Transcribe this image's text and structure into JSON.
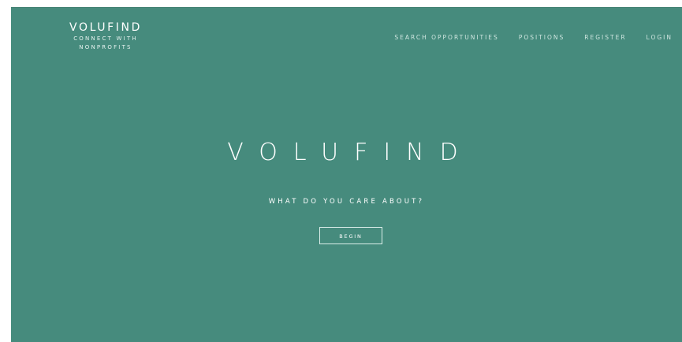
{
  "brand": {
    "title": "VOLUFIND",
    "tagline_line1": "CONNECT WITH",
    "tagline_line2": "NONPROFITS"
  },
  "nav": {
    "items": [
      {
        "label": "SEARCH OPPORTUNITIES"
      },
      {
        "label": "POSITIONS"
      },
      {
        "label": "REGISTER"
      },
      {
        "label": "LOGIN"
      }
    ]
  },
  "hero": {
    "title": "VOLUFIND",
    "subtitle": "WHAT DO YOU CARE ABOUT?",
    "button_label": "BEGIN"
  },
  "colors": {
    "hero_background": "#468b7d",
    "text": "#ffffff"
  }
}
